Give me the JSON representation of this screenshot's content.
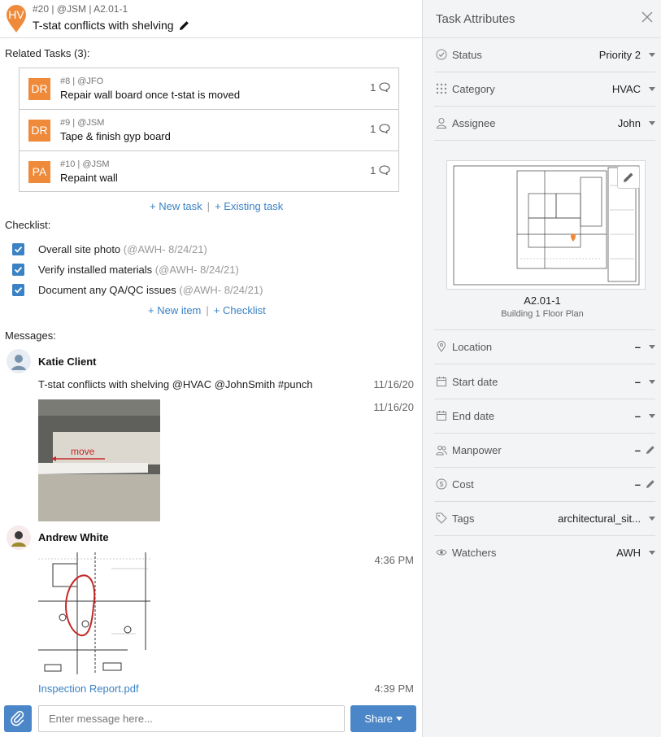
{
  "header": {
    "avatar_initials": "HV",
    "meta": "#20 | @JSM | A2.01-1",
    "title": "T-stat conflicts with shelving",
    "accent": "#ef8a3a"
  },
  "related": {
    "label": "Related Tasks (3):",
    "tasks": [
      {
        "initials": "DR",
        "meta": "#8 | @JFO",
        "name": "Repair wall board once t-stat is moved",
        "comments": "1"
      },
      {
        "initials": "DR",
        "meta": "#9 | @JSM",
        "name": "Tape & finish gyp board",
        "comments": "1"
      },
      {
        "initials": "PA",
        "meta": "#10 | @JSM",
        "name": "Repaint wall",
        "comments": "1"
      }
    ],
    "new_task": "+ New task",
    "existing_task": "+ Existing task"
  },
  "checklist": {
    "label": "Checklist:",
    "items": [
      {
        "text": "Overall site photo",
        "by": "(@AWH- 8/24/21)",
        "checked": true
      },
      {
        "text": "Verify installed materials",
        "by": "(@AWH- 8/24/21)",
        "checked": true
      },
      {
        "text": "Document any QA/QC issues",
        "by": "(@AWH- 8/24/21)",
        "checked": true
      }
    ],
    "new_item": "+ New item",
    "add_checklist": "+ Checklist"
  },
  "messages": {
    "label": "Messages:",
    "items": [
      {
        "author": "Katie Client",
        "text": "T-stat conflicts with shelving @HVAC @JohnSmith #punch",
        "time": "11/16/20",
        "photo_time": "11/16/20",
        "photo_annotation": "move"
      },
      {
        "author": "Andrew White",
        "plan_time": "4:36 PM",
        "attachment": "Inspection Report.pdf",
        "attachment_time": "4:39 PM"
      }
    ],
    "input_placeholder": "Enter message here...",
    "share_label": "Share"
  },
  "attributes": {
    "title": "Task Attributes",
    "status": {
      "label": "Status",
      "value": "Priority 2"
    },
    "category": {
      "label": "Category",
      "value": "HVAC"
    },
    "assignee": {
      "label": "Assignee",
      "value": "John"
    },
    "sheet": {
      "name": "A2.01-1",
      "subtitle": "Building 1 Floor Plan"
    },
    "location": {
      "label": "Location",
      "value": "–"
    },
    "start_date": {
      "label": "Start date",
      "value": "–"
    },
    "end_date": {
      "label": "End date",
      "value": "–"
    },
    "manpower": {
      "label": "Manpower",
      "value": "–"
    },
    "cost": {
      "label": "Cost",
      "value": "–"
    },
    "tags": {
      "label": "Tags",
      "value": "architectural_sit..."
    },
    "watchers": {
      "label": "Watchers",
      "value": "AWH"
    }
  },
  "colors": {
    "link": "#3b82c4",
    "button": "#4a86c8",
    "avatar": "#ef8a3a",
    "panel_bg": "#f3f4f6"
  }
}
